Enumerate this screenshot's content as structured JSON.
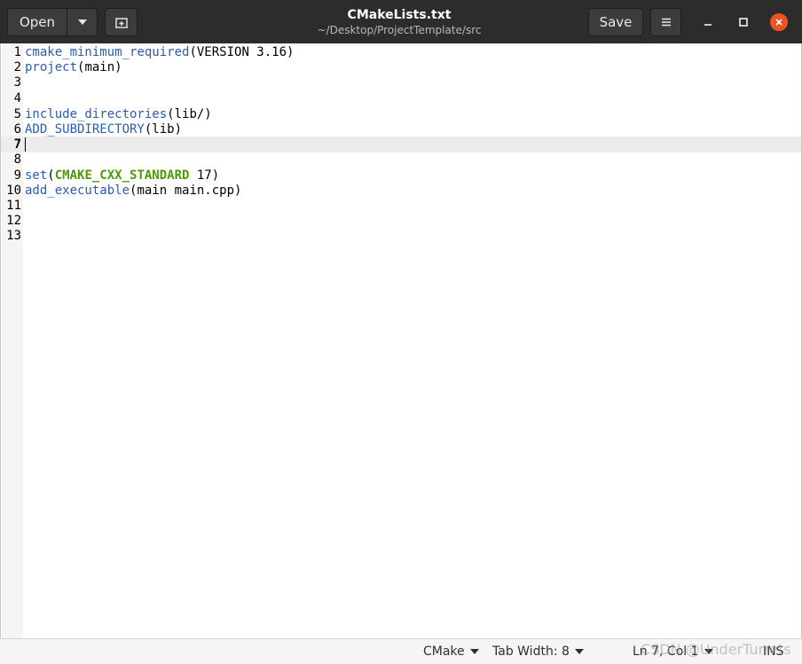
{
  "header": {
    "open_label": "Open",
    "save_label": "Save",
    "title": "CMakeLists.txt",
    "subtitle": "~/Desktop/ProjectTemplate/src"
  },
  "editor": {
    "current_line": 7,
    "lines": [
      {
        "num": "1",
        "parts": [
          {
            "t": "cmake_minimum_required",
            "k": "fn"
          },
          {
            "t": "(VERSION 3.16)",
            "k": "plain"
          }
        ]
      },
      {
        "num": "2",
        "parts": [
          {
            "t": "project",
            "k": "fn"
          },
          {
            "t": "(main)",
            "k": "plain"
          }
        ]
      },
      {
        "num": "3",
        "parts": []
      },
      {
        "num": "4",
        "parts": []
      },
      {
        "num": "5",
        "parts": [
          {
            "t": "include_directories",
            "k": "fn"
          },
          {
            "t": "(lib/)",
            "k": "plain"
          }
        ]
      },
      {
        "num": "6",
        "parts": [
          {
            "t": "ADD_SUBDIRECTORY",
            "k": "fn"
          },
          {
            "t": "(lib)",
            "k": "plain"
          }
        ]
      },
      {
        "num": "7",
        "parts": []
      },
      {
        "num": "8",
        "parts": []
      },
      {
        "num": "9",
        "parts": [
          {
            "t": "set",
            "k": "fn"
          },
          {
            "t": "(",
            "k": "plain"
          },
          {
            "t": "CMAKE_CXX_STANDARD",
            "k": "var"
          },
          {
            "t": " 17)",
            "k": "plain"
          }
        ]
      },
      {
        "num": "10",
        "parts": [
          {
            "t": "add_executable",
            "k": "fn"
          },
          {
            "t": "(main main.cpp)",
            "k": "plain"
          }
        ]
      },
      {
        "num": "11",
        "parts": []
      },
      {
        "num": "12",
        "parts": []
      },
      {
        "num": "13",
        "parts": []
      }
    ]
  },
  "status": {
    "language": "CMake",
    "tab_width": "Tab Width: 8",
    "position": "Ln 7, Col 1",
    "mode": "INS",
    "watermark": "CSDN @UnderTurrets"
  },
  "colors": {
    "function": "#2a5db0",
    "variable": "#4e9a06",
    "close_button": "#e95420",
    "header_bg": "#2c2c2c"
  },
  "icons": {
    "dropdown": "chevron-down-icon",
    "new_tab": "new-tab-icon",
    "menu": "hamburger-menu-icon",
    "minimize": "minimize-icon",
    "maximize": "maximize-icon",
    "close": "close-icon"
  }
}
